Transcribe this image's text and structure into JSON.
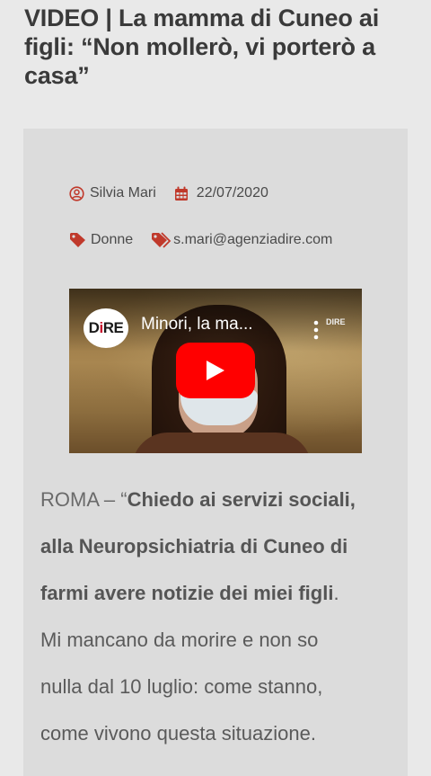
{
  "article": {
    "title": "VIDEO | La mamma di Cuneo ai figli: “Non mollerò, vi porterò a casa”",
    "author": "Silvia Mari",
    "date": "22/07/2020",
    "tags": [
      "Donne",
      "s.mari@agenziadire.com"
    ],
    "body": {
      "lead": "ROMA – “",
      "bold_line1": "Chiedo ai servizi sociali,",
      "bold_line2": "alla Neuropsichiatria di Cuneo di",
      "bold_line3": "farmi avere notizie dei miei figli",
      "period": ".",
      "line4": "Mi mancano da morire e non so",
      "line5": "nulla dal 10 luglio: come stanno,",
      "line6": "come vivono questa situazione."
    }
  },
  "video": {
    "title": "Minori, la ma...",
    "channel_logo_text_a": "D",
    "channel_logo_text_b": "i",
    "channel_logo_text_c": "RE",
    "watermark": "DIRE"
  },
  "colors": {
    "accent": "#c0392b",
    "play_button": "#ff0000",
    "page_background": "#e9e9e9",
    "card_background": "#dcdcdc"
  },
  "icons": {
    "author": "user-circle-icon",
    "date": "calendar-icon",
    "tag": "tag-icon",
    "play": "play-icon",
    "more": "more-vertical-icon"
  }
}
